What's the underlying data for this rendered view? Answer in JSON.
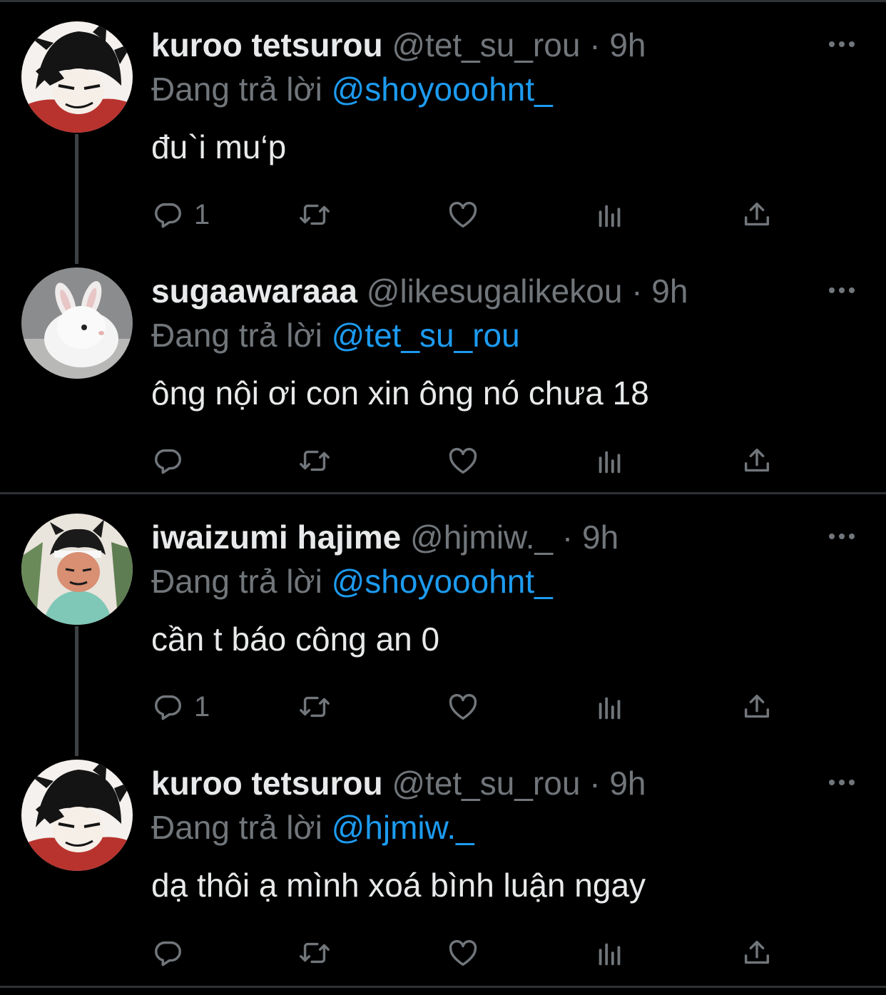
{
  "colors": {
    "background": "#000000",
    "text": "#e7e9ea",
    "muted": "#71767b",
    "accent": "#1d9bf0",
    "divider": "#2f3336"
  },
  "threads": [
    {
      "tweets": [
        {
          "avatar": "kuroo-avatar",
          "display_name": "kuroo tetsurou",
          "handle": "@tet_su_rou",
          "separator": "·",
          "time": "9h",
          "reply_label": "Đang trả lời",
          "reply_to": "@shoyooohnt_",
          "text": "đu`i mu‘p",
          "reply_count": "1",
          "show_connector": true
        },
        {
          "avatar": "bunny-avatar",
          "display_name": "sugaawaraaa",
          "handle": "@likesugalikekou",
          "separator": "·",
          "time": "9h",
          "reply_label": "Đang trả lời",
          "reply_to": "@tet_su_rou",
          "text": "ông nội ơi con xin ông nó chưa 18",
          "reply_count": "",
          "show_connector": false
        }
      ]
    },
    {
      "tweets": [
        {
          "avatar": "iwaizumi-avatar",
          "display_name": "iwaizumi hajime",
          "handle": "@hjmiw._",
          "separator": "·",
          "time": "9h",
          "reply_label": "Đang trả lời",
          "reply_to": "@shoyooohnt_",
          "text": "cần t báo công an 0",
          "reply_count": "1",
          "show_connector": true
        },
        {
          "avatar": "kuroo-avatar",
          "display_name": "kuroo tetsurou",
          "handle": "@tet_su_rou",
          "separator": "·",
          "time": "9h",
          "reply_label": "Đang trả lời",
          "reply_to": "@hjmiw._",
          "text": "dạ thôi ạ mình xoá bình luận ngay",
          "reply_count": "",
          "show_connector": false
        }
      ]
    }
  ],
  "action_icons": [
    "reply-icon",
    "retweet-icon",
    "like-icon",
    "analytics-icon",
    "share-icon"
  ]
}
